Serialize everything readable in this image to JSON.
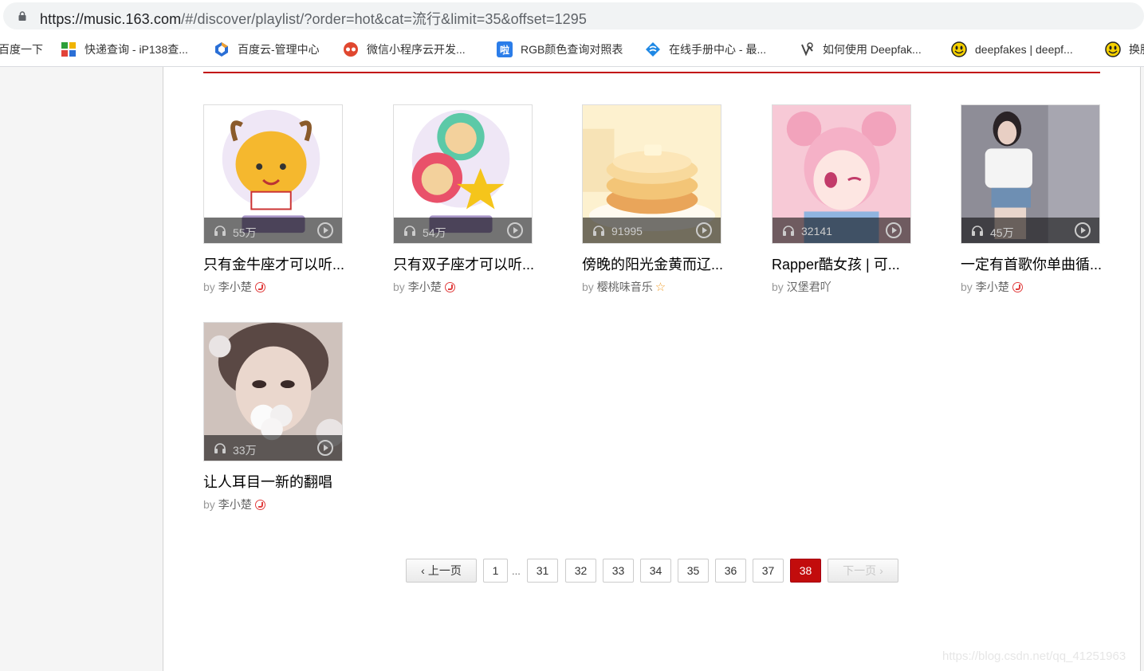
{
  "browser": {
    "url_prefix": "https://music.163.com",
    "url_rest": "/#/discover/playlist/?order=hot&cat=流行&limit=35&offset=1295"
  },
  "bookmarks": [
    {
      "label": "百度一下",
      "icon": "baidu-icon",
      "color": "#ffffff"
    },
    {
      "label": "快递查询 - iP138查...",
      "icon": "ip138-icon",
      "color": "#2d9f3a"
    },
    {
      "label": "百度云-管理中心",
      "icon": "baidu-cloud-icon",
      "color": "#2a6fd6"
    },
    {
      "label": "微信小程序云开发...",
      "icon": "wechat-dev-icon",
      "color": "#e0472f"
    },
    {
      "label": "RGB颜色查询对照表",
      "icon": "rgb-icon",
      "color": "#2b7de9"
    },
    {
      "label": "在线手册中心 - 最...",
      "icon": "manual-icon",
      "color": "#1e88e5"
    },
    {
      "label": "如何使用 Deepfak...",
      "icon": "deepfake-icon",
      "color": "#444444"
    },
    {
      "label": "deepfakes | deepf...",
      "icon": "deepfakes-icon",
      "color": "#f5d000"
    },
    {
      "label": "换肤",
      "icon": "skin-icon",
      "color": "#f5d000"
    }
  ],
  "playlists": [
    {
      "title": "只有金牛座才可以听...",
      "by": "by",
      "author": "李小楚",
      "count": "55万",
      "badge": "music-badge-icon",
      "cover_colors": [
        "#f4f0f8",
        "#f5b82e"
      ]
    },
    {
      "title": "只有双子座才可以听...",
      "by": "by",
      "author": "李小楚",
      "count": "54万",
      "badge": "music-badge-icon",
      "cover_colors": [
        "#f4eff8",
        "#e9516a"
      ]
    },
    {
      "title": "傍晚的阳光金黄而辽...",
      "by": "by",
      "author": "樱桃味音乐",
      "count": "91995",
      "badge": "star-icon",
      "cover_colors": [
        "#fdf1cf",
        "#f3c577"
      ]
    },
    {
      "title": "Rapper酷女孩 | 可...",
      "by": "by",
      "author": "汉堡君吖",
      "count": "32141",
      "badge": "",
      "cover_colors": [
        "#f7c9d6",
        "#f2a3bc"
      ]
    },
    {
      "title": "一定有首歌你单曲循...",
      "by": "by",
      "author": "李小楚",
      "count": "45万",
      "badge": "music-badge-icon",
      "cover_colors": [
        "#9b9aa4",
        "#6f7080"
      ]
    },
    {
      "title": "让人耳目一新的翻唱",
      "by": "by",
      "author": "李小楚",
      "count": "33万",
      "badge": "music-badge-icon",
      "cover_colors": [
        "#cfc2bc",
        "#7a6d68"
      ]
    }
  ],
  "pagination": {
    "prev": "上一页",
    "first": "1",
    "ellipsis": "...",
    "pages": [
      "31",
      "32",
      "33",
      "34",
      "35",
      "36",
      "37",
      "38"
    ],
    "current": "38",
    "next": "下一页"
  },
  "watermark": "https://blog.csdn.net/qq_41251963"
}
